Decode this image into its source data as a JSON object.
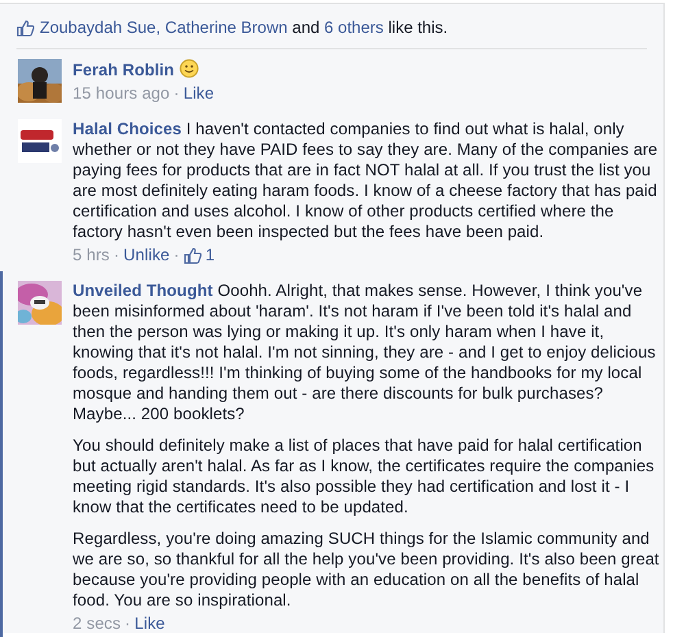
{
  "likes": [
    {
      "text": "Zoubaydah Sue,",
      "kind": "link"
    },
    {
      "text": "Catherine Brown",
      "kind": "link"
    },
    {
      "text": "and",
      "kind": "plain"
    },
    {
      "text": "6 others",
      "kind": "link"
    },
    {
      "text": "like this.",
      "kind": "plain"
    }
  ],
  "comments": [
    {
      "author": "Ferah Roblin",
      "emoticon": true,
      "meta": [
        {
          "text": "15 hours ago",
          "kind": "time"
        },
        {
          "text": "·",
          "kind": "dot"
        },
        {
          "text": "Like",
          "kind": "link"
        }
      ],
      "highlighted": false
    },
    {
      "author": "Halal Choices",
      "paragraphs": [
        "I haven't contacted companies to find out what is halal, only whether or not they have PAID fees to say they are. Many of the companies are paying fees for products that are in fact NOT halal at all. If you trust the list you are most definitely eating haram foods. I know of a cheese factory that has paid certification and uses alcohol. I know of other products certified where the factory hasn't even been inspected but the fees have been paid."
      ],
      "meta": [
        {
          "text": "5 hrs",
          "kind": "time"
        },
        {
          "text": "·",
          "kind": "dot"
        },
        {
          "text": "Unlike",
          "kind": "link"
        },
        {
          "text": "·",
          "kind": "dot"
        },
        {
          "text": "1",
          "kind": "likes"
        }
      ],
      "highlighted": false
    },
    {
      "author": "Unveiled Thought",
      "paragraphs": [
        "Ooohh. Alright, that makes sense. However, I think you've been misinformed about 'haram'. It's not haram if I've been told it's halal and then the person was lying or making it up. It's only haram when I have it, knowing that it's not halal. I'm not sinning, they are - and I get to enjoy delicious foods, regardless!!! I'm thinking of buying some of the handbooks for my local mosque and handing them out - are there discounts for bulk purchases? Maybe... 200 booklets?",
        "You should definitely make a list of places that have paid for halal certification but actually aren't halal. As far as I know, the certificates require the companies meeting rigid standards. It's also possible they had certification and lost it - I know that the certificates need to be updated.",
        "Regardless, you're doing amazing SUCH things for the Islamic community and we are so, so thankful for all the help you've been providing. It's also been great because you're providing people with an education on all the benefits of halal food. You are so inspirational."
      ],
      "meta": [
        {
          "text": "2 secs",
          "kind": "time"
        },
        {
          "text": "·",
          "kind": "dot"
        },
        {
          "text": "Like",
          "kind": "link"
        }
      ],
      "highlighted": true
    }
  ]
}
